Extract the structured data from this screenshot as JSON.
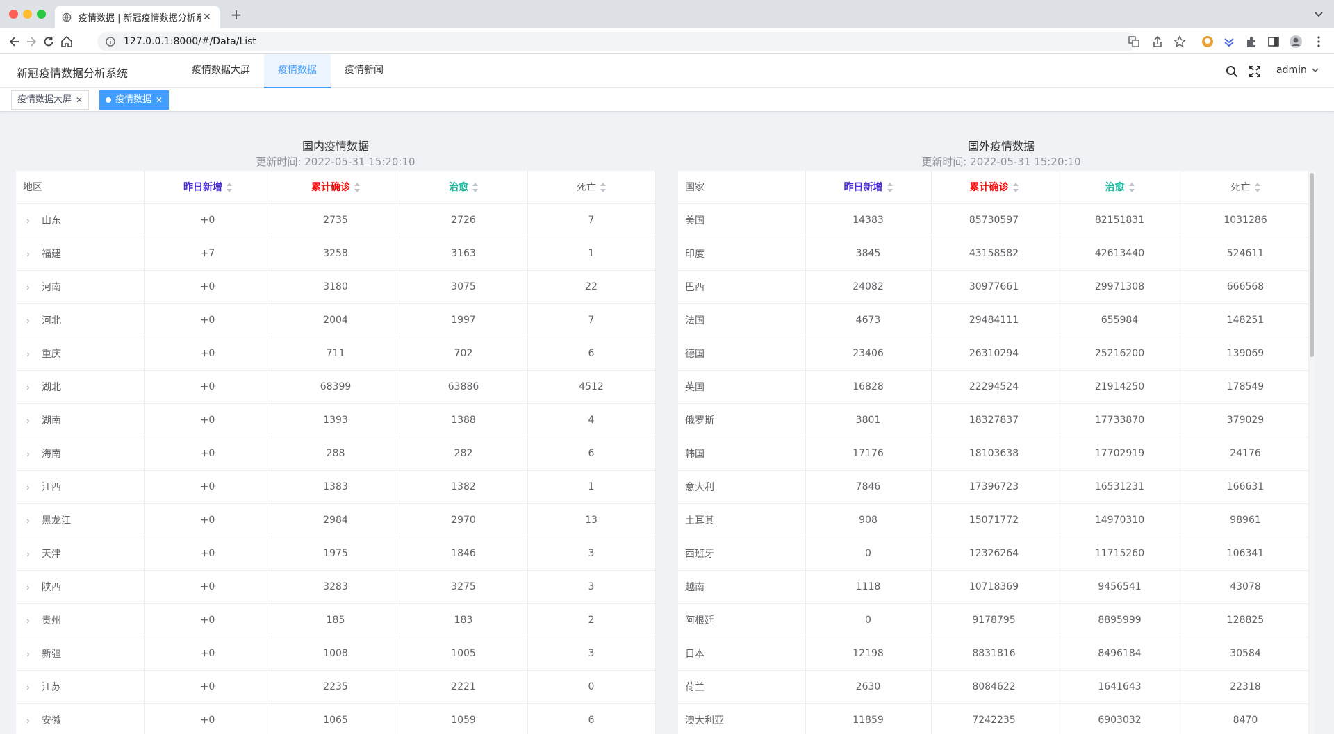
{
  "browser": {
    "tab_title": "疫情数据 | 新冠疫情数据分析系统",
    "url": "127.0.0.1:8000/#/Data/List"
  },
  "app": {
    "title": "新冠疫情数据分析系统",
    "nav": [
      "疫情数据大屏",
      "疫情数据",
      "疫情新闻"
    ],
    "user": "admin"
  },
  "tags": [
    "疫情数据大屏",
    "疫情数据"
  ],
  "domestic": {
    "title": "国内疫情数据",
    "update_time": "更新时间: 2022-05-31 15:20:10",
    "columns": [
      "地区",
      "昨日新增",
      "累计确诊",
      "治愈",
      "死亡"
    ],
    "rows": [
      [
        "山东",
        "+0",
        "2735",
        "2726",
        "7"
      ],
      [
        "福建",
        "+7",
        "3258",
        "3163",
        "1"
      ],
      [
        "河南",
        "+0",
        "3180",
        "3075",
        "22"
      ],
      [
        "河北",
        "+0",
        "2004",
        "1997",
        "7"
      ],
      [
        "重庆",
        "+0",
        "711",
        "702",
        "6"
      ],
      [
        "湖北",
        "+0",
        "68399",
        "63886",
        "4512"
      ],
      [
        "湖南",
        "+0",
        "1393",
        "1388",
        "4"
      ],
      [
        "海南",
        "+0",
        "288",
        "282",
        "6"
      ],
      [
        "江西",
        "+0",
        "1383",
        "1382",
        "1"
      ],
      [
        "黑龙江",
        "+0",
        "2984",
        "2970",
        "13"
      ],
      [
        "天津",
        "+0",
        "1975",
        "1846",
        "3"
      ],
      [
        "陕西",
        "+0",
        "3283",
        "3275",
        "3"
      ],
      [
        "贵州",
        "+0",
        "185",
        "183",
        "2"
      ],
      [
        "新疆",
        "+0",
        "1008",
        "1005",
        "3"
      ],
      [
        "江苏",
        "+0",
        "2235",
        "2221",
        "0"
      ],
      [
        "安徽",
        "+0",
        "1065",
        "1059",
        "6"
      ]
    ]
  },
  "foreign": {
    "title": "国外疫情数据",
    "update_time": "更新时间: 2022-05-31 15:20:10",
    "columns": [
      "国家",
      "昨日新增",
      "累计确诊",
      "治愈",
      "死亡"
    ],
    "rows": [
      [
        "美国",
        "14383",
        "85730597",
        "82151831",
        "1031286"
      ],
      [
        "印度",
        "3845",
        "43158582",
        "42613440",
        "524611"
      ],
      [
        "巴西",
        "24082",
        "30977661",
        "29971308",
        "666568"
      ],
      [
        "法国",
        "4673",
        "29484111",
        "655984",
        "148251"
      ],
      [
        "德国",
        "23406",
        "26310294",
        "25216200",
        "139069"
      ],
      [
        "英国",
        "16828",
        "22294524",
        "21914250",
        "178549"
      ],
      [
        "俄罗斯",
        "3801",
        "18327837",
        "17733870",
        "379029"
      ],
      [
        "韩国",
        "17176",
        "18103638",
        "17702919",
        "24176"
      ],
      [
        "意大利",
        "7846",
        "17396723",
        "16531231",
        "166631"
      ],
      [
        "土耳其",
        "908",
        "15071772",
        "14970310",
        "98961"
      ],
      [
        "西班牙",
        "0",
        "12326264",
        "11715260",
        "106341"
      ],
      [
        "越南",
        "1118",
        "10718369",
        "9456541",
        "43078"
      ],
      [
        "阿根廷",
        "0",
        "9178795",
        "8895999",
        "128825"
      ],
      [
        "日本",
        "12198",
        "8831816",
        "8496184",
        "30584"
      ],
      [
        "荷兰",
        "2630",
        "8084622",
        "1641643",
        "22318"
      ],
      [
        "澳大利亚",
        "11859",
        "7242235",
        "6903032",
        "8470"
      ]
    ]
  }
}
